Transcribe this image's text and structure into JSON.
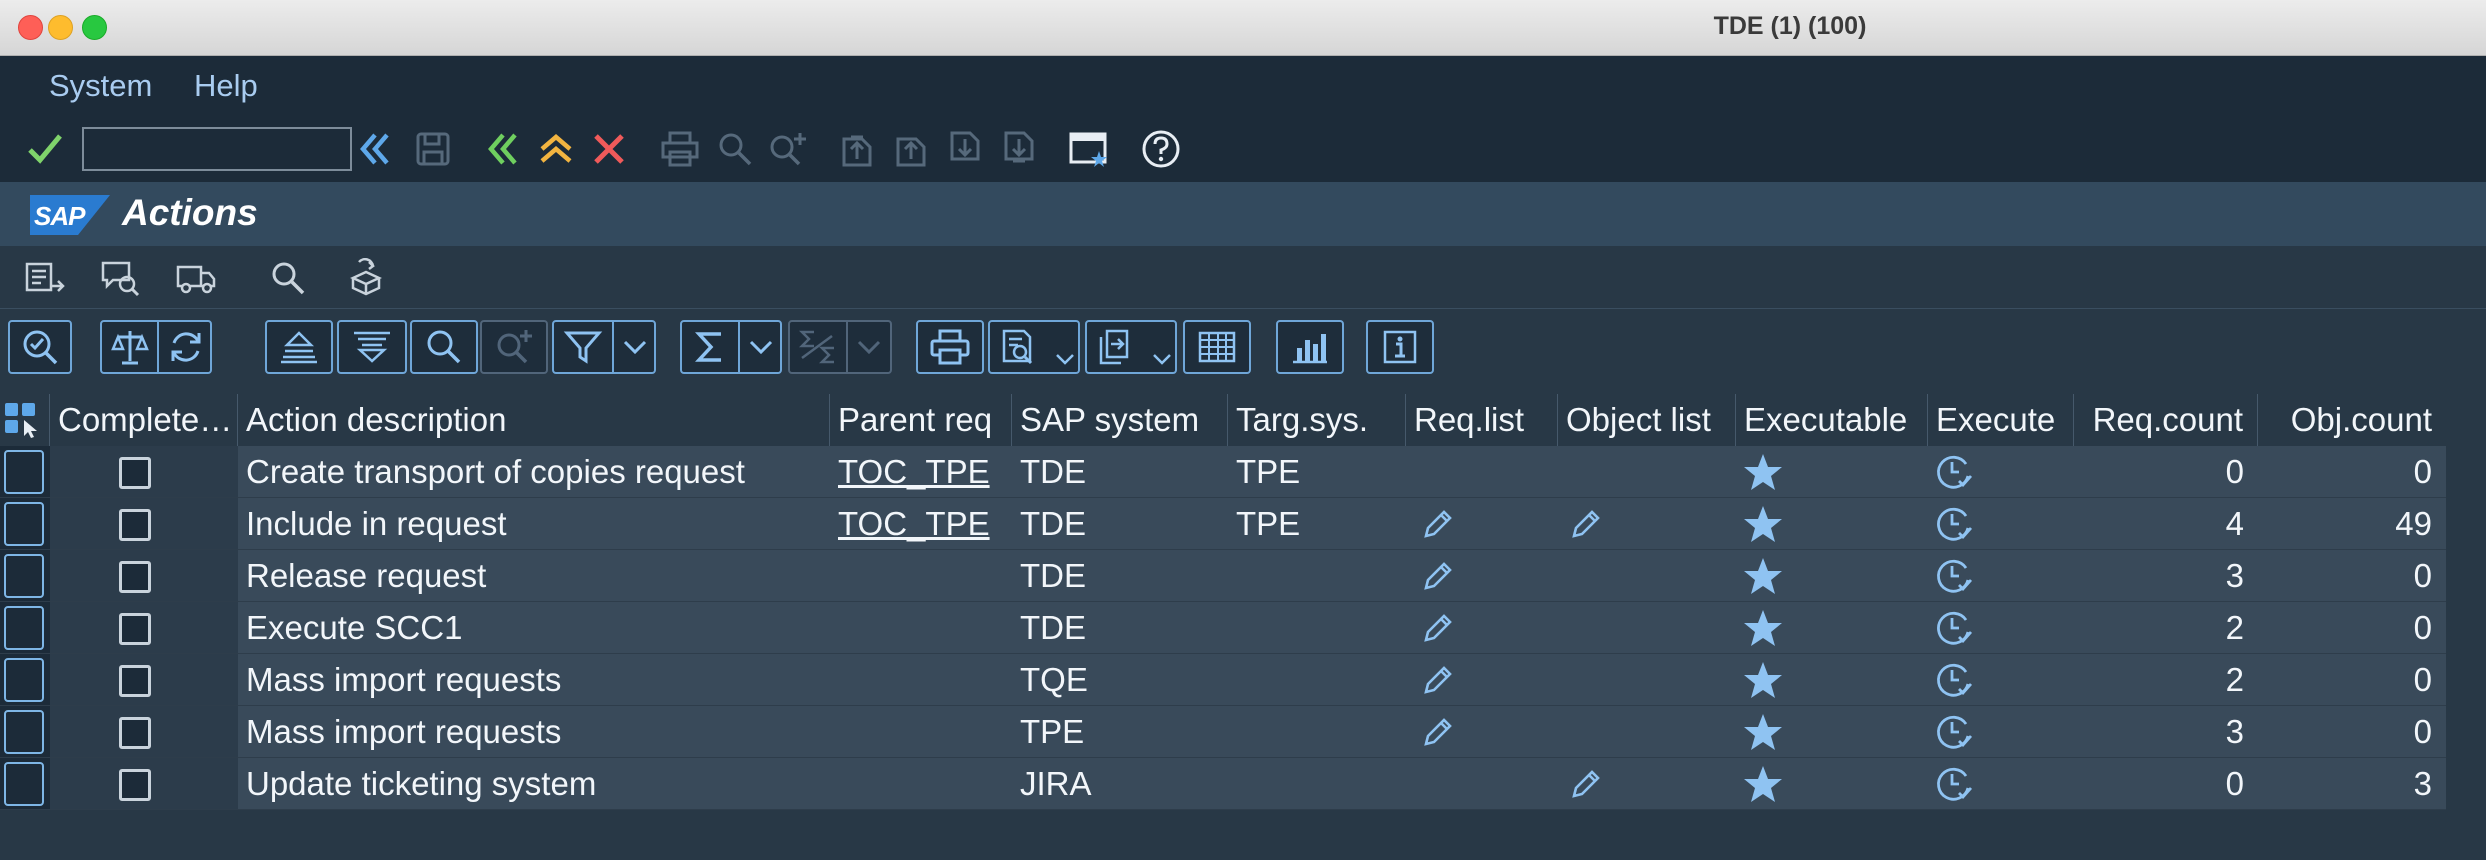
{
  "window": {
    "title": "TDE (1) (100)"
  },
  "menu": {
    "items": [
      "System",
      "Help"
    ]
  },
  "toolbar": {
    "okcode_value": ""
  },
  "page": {
    "title": "Actions",
    "logo_text": "SAP"
  },
  "table": {
    "columns": [
      "Complete…",
      "Action description",
      "Parent req",
      "SAP system",
      "Targ.sys.",
      "Req.list",
      "Object list",
      "Executable",
      "Execute",
      "Req.count",
      "Obj.count"
    ],
    "rows": [
      {
        "description": "Create transport of copies request",
        "parent_req": "TOC_TPE",
        "sap_system": "TDE",
        "targ_sys": "TPE",
        "req_list": false,
        "object_list": false,
        "executable": "star-icon",
        "execute": "clock-check-icon",
        "req_count": "0",
        "obj_count": "0"
      },
      {
        "description": "Include in request",
        "parent_req": "TOC_TPE",
        "sap_system": "TDE",
        "targ_sys": "TPE",
        "req_list": true,
        "object_list": true,
        "executable": "star-icon",
        "execute": "clock-check-icon",
        "req_count": "4",
        "obj_count": "49"
      },
      {
        "description": "Release request",
        "parent_req": "",
        "sap_system": "TDE",
        "targ_sys": "",
        "req_list": true,
        "object_list": false,
        "executable": "star-icon",
        "execute": "clock-check-icon",
        "req_count": "3",
        "obj_count": "0"
      },
      {
        "description": "Execute SCC1",
        "parent_req": "",
        "sap_system": "TDE",
        "targ_sys": "",
        "req_list": true,
        "object_list": false,
        "executable": "star-icon",
        "execute": "clock-check-icon",
        "req_count": "2",
        "obj_count": "0"
      },
      {
        "description": "Mass import requests",
        "parent_req": "",
        "sap_system": "TQE",
        "targ_sys": "",
        "req_list": true,
        "object_list": false,
        "executable": "star-icon",
        "execute": "clock-check-icon",
        "req_count": "2",
        "obj_count": "0"
      },
      {
        "description": "Mass import requests",
        "parent_req": "",
        "sap_system": "TPE",
        "targ_sys": "",
        "req_list": true,
        "object_list": false,
        "executable": "star-icon",
        "execute": "clock-check-icon",
        "req_count": "3",
        "obj_count": "0"
      },
      {
        "description": "Update ticketing system",
        "parent_req": "",
        "sap_system": "JIRA",
        "targ_sys": "",
        "req_list": false,
        "object_list": true,
        "executable": "star-icon",
        "execute": "clock-check-icon",
        "req_count": "0",
        "obj_count": "3"
      }
    ]
  },
  "colors": {
    "background": "#283846",
    "accent": "#a9ccf0",
    "row_bg": "#394a5a",
    "star": "#8fc3f2"
  }
}
